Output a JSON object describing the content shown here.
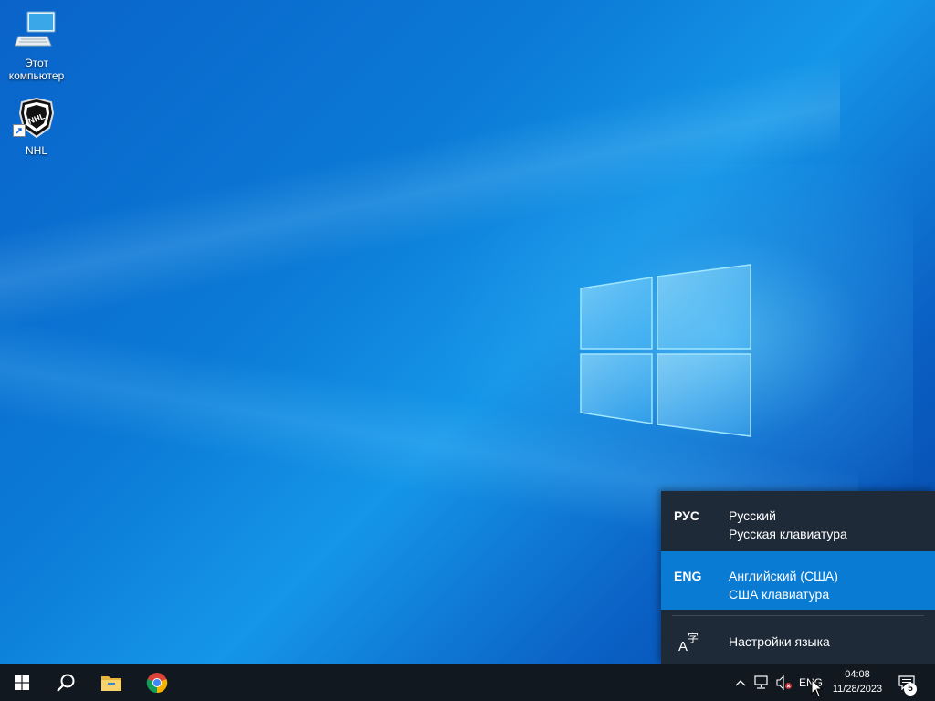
{
  "desktop": {
    "icons": [
      {
        "label": "Этот компьютер",
        "icon": "computer-icon"
      },
      {
        "label": "NHL",
        "icon": "nhl-shortcut-icon"
      }
    ]
  },
  "language_popup": {
    "items": [
      {
        "code": "РУС",
        "name": "Русский",
        "keyboard": "Русская клавиатура",
        "selected": false
      },
      {
        "code": "ENG",
        "name": "Английский (США)",
        "keyboard": "США клавиатура",
        "selected": true
      }
    ],
    "settings_label": "Настройки языка"
  },
  "taskbar": {
    "start_icon": "windows-start-icon",
    "search_icon": "search-icon",
    "pinned": [
      {
        "name": "file-explorer",
        "icon": "folder-icon"
      },
      {
        "name": "chrome",
        "icon": "chrome-icon"
      }
    ],
    "tray": {
      "language": "ENG",
      "time": "04:08",
      "date": "11/28/2023",
      "notifications_count": "5"
    }
  },
  "colors": {
    "popup_bg": "#1f2a38",
    "selected_row": "#0a7bd3",
    "taskbar_bg": "#121820"
  }
}
